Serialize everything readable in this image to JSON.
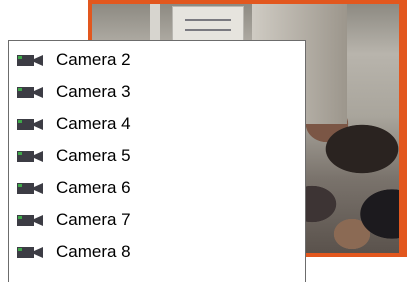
{
  "camera_list": {
    "items": [
      {
        "label": "Camera 2",
        "icon": "video-camera-icon"
      },
      {
        "label": "Camera 3",
        "icon": "video-camera-icon"
      },
      {
        "label": "Camera 4",
        "icon": "video-camera-icon"
      },
      {
        "label": "Camera 5",
        "icon": "video-camera-icon"
      },
      {
        "label": "Camera 6",
        "icon": "video-camera-icon"
      },
      {
        "label": "Camera 7",
        "icon": "video-camera-icon"
      },
      {
        "label": "Camera 8",
        "icon": "video-camera-icon"
      }
    ]
  },
  "colors": {
    "video_border": "#e2571e",
    "icon_body": "#3c3c44",
    "icon_accent": "#3fa84a"
  }
}
